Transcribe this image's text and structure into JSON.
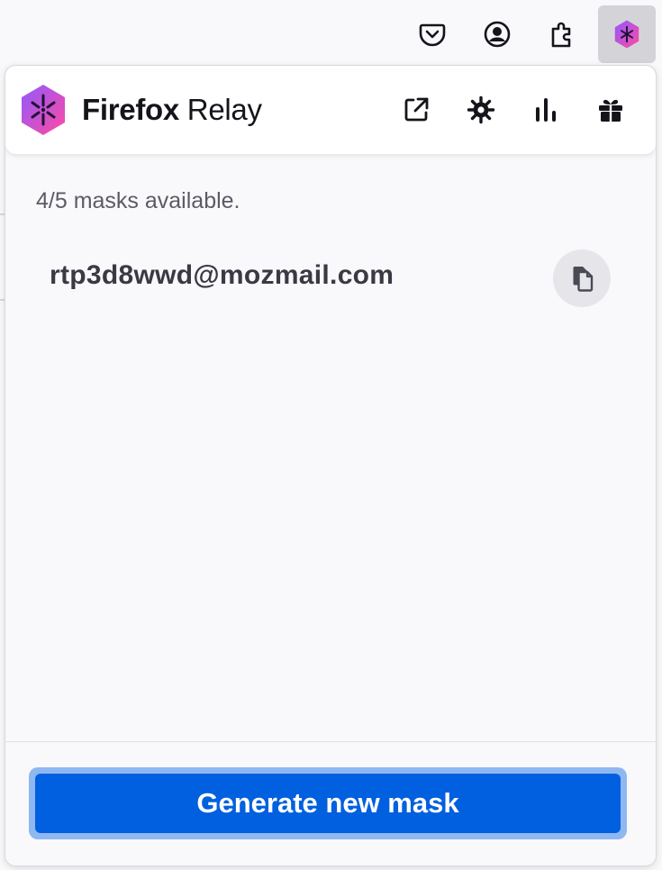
{
  "toolbar": {
    "icons": [
      "pocket-icon",
      "account-icon",
      "extensions-icon",
      "relay-extension-icon"
    ]
  },
  "header": {
    "brand_bold": "Firefox",
    "brand_regular": "Relay",
    "icons": [
      "open-dashboard-icon",
      "settings-icon",
      "stats-icon",
      "gift-icon"
    ]
  },
  "masks": {
    "available_text": "4/5 masks available.",
    "items": [
      {
        "address": "rtp3d8wwd@mozmail.com"
      }
    ]
  },
  "footer": {
    "generate_label": "Generate new mask"
  },
  "colors": {
    "primary_button": "#0060df",
    "button_focus_ring": "#8fb7f2",
    "brand_gradient_start": "#9059ff",
    "brand_gradient_end": "#ff4aa2"
  }
}
